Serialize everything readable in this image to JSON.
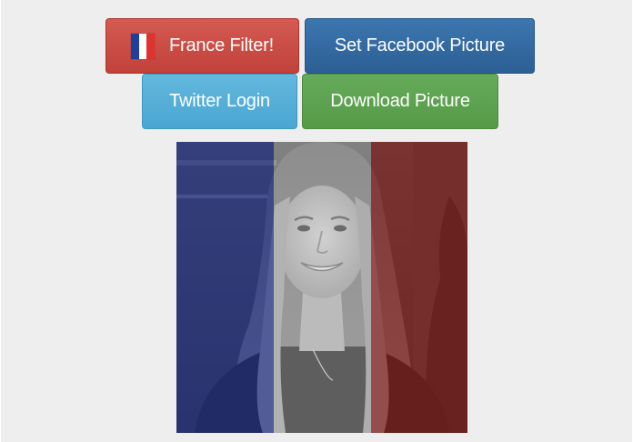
{
  "buttons": {
    "france_filter": "France Filter!",
    "set_facebook_picture": "Set Facebook Picture",
    "twitter_login": "Twitter Login",
    "download_picture": "Download Picture"
  },
  "flag": {
    "colors": [
      "#1f3f9f",
      "#ffffff",
      "#e0322f"
    ],
    "icon": "france-flag-icon"
  },
  "photo": {
    "overlay_colors": [
      "#1e2f8e",
      "#c8c8c8",
      "#8e1b17"
    ]
  }
}
